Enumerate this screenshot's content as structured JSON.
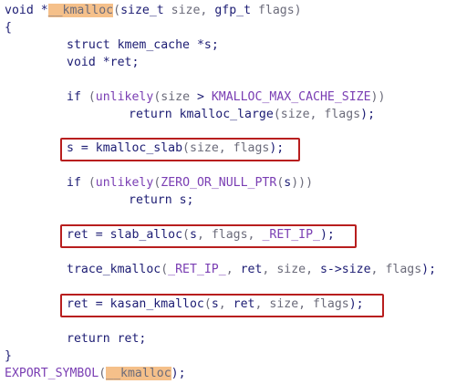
{
  "code": {
    "l1": {
      "void": "void *",
      "name": "__kmalloc",
      "open": "(",
      "t1": "size_t",
      "sp1": " ",
      "p1": "size",
      "comma1": ", ",
      "t2": "gfp_t",
      "sp2": " ",
      "p2": "flags",
      "close": ")"
    },
    "l2": "{",
    "l3": {
      "kw": "struct",
      "sp": " ",
      "ty": "kmem_cache",
      "rest": " *s;"
    },
    "l4": {
      "kw": "void",
      "rest": " *ret;"
    },
    "l6": {
      "kw": "if",
      "sp": " (",
      "fn": "unlikely",
      "o": "(",
      "a": "size",
      "op": " > ",
      "mac": "KMALLOC_MAX_CACHE_SIZE",
      "c": "))"
    },
    "l7": {
      "kw": "return",
      "sp": " ",
      "fn": "kmalloc_large",
      "o": "(",
      "a": "size",
      "cm": ", ",
      "b": "flags",
      "c": ");"
    },
    "l8": {
      "lhs": "s = ",
      "fn": "kmalloc_slab",
      "o": "(",
      "a": "size",
      "cm": ", ",
      "b": "flags",
      "c": ");"
    },
    "l10": {
      "kw": "if",
      "sp": " (",
      "fn": "unlikely",
      "o": "(",
      "mac": "ZERO_OR_NULL_PTR",
      "o2": "(",
      "a": "s",
      "c": ")))"
    },
    "l11": {
      "kw": "return",
      "rest": " s;"
    },
    "l13": {
      "lhs": "ret = ",
      "fn": "slab_alloc",
      "o": "(",
      "a": "s",
      "cm": ", ",
      "b": "flags",
      "cm2": ", ",
      "mac": "_RET_IP_",
      "c": ");"
    },
    "l15": {
      "fn": "trace_kmalloc",
      "o": "(",
      "mac": "_RET_IP_",
      "cm": ", ",
      "a": "ret",
      "cm2": ", ",
      "b": "size",
      "cm3": ", ",
      "c1": "s->size",
      "cm4": ", ",
      "d": "flags",
      "c": ");"
    },
    "l17": {
      "lhs": "ret = ",
      "fn": "kasan_kmalloc",
      "o": "(",
      "a": "s",
      "cm": ", ",
      "b": "ret",
      "cm2": ", ",
      "c1": "size",
      "cm3": ", ",
      "d": "flags",
      "c": ");"
    },
    "l19": {
      "kw": "return",
      "rest": " ret;"
    },
    "l20": "}",
    "l21": {
      "mac": "EXPORT_SYMBOL",
      "o": "(",
      "name": "__kmalloc",
      "c": ");"
    }
  },
  "colors": {
    "keyword": "#1c1c73",
    "macro": "#7a3eb3",
    "highlight_bg": "#f5c08a",
    "box_border": "#b81e1e"
  }
}
